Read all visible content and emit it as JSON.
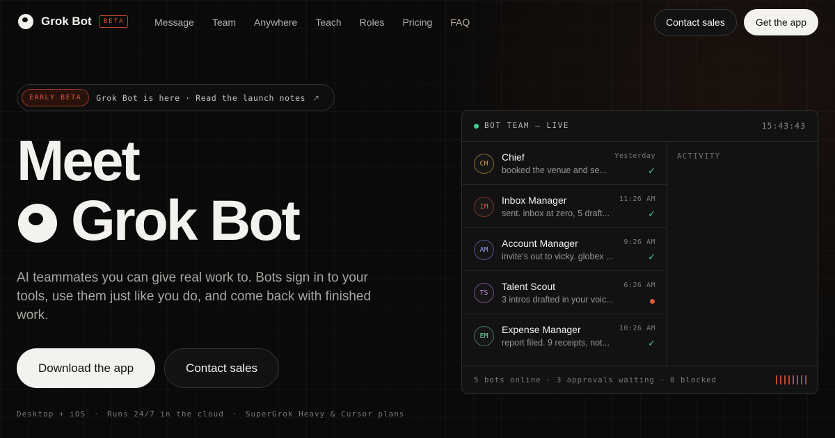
{
  "nav": {
    "brand": "Grok Bot",
    "beta_badge": "BETA",
    "links": [
      "Message",
      "Team",
      "Anywhere",
      "Teach",
      "Roles",
      "Pricing",
      "FAQ"
    ],
    "contact_sales": "Contact sales",
    "get_app": "Get the app"
  },
  "announce": {
    "badge": "EARLY BETA",
    "text": "Grok Bot is here · Read the launch notes",
    "arrow": "↗"
  },
  "hero": {
    "line1": "Meet",
    "line2": "Grok Bot",
    "subtitle": "AI teammates you can give real work to. Bots sign in to your tools, use them just like you do, and come back with finished work.",
    "download_button": "Download the app",
    "contact_button": "Contact sales",
    "footnotes": [
      "Desktop + iOS",
      "Runs 24/7 in the cloud",
      "SuperGrok Heavy & Cursor plans"
    ],
    "footnote_sep": "·"
  },
  "panel": {
    "title": "BOT TEAM — LIVE",
    "clock": "15:43:43",
    "activity_label": "ACTIVITY",
    "footer": "5 bots online · 3 approvals waiting · 0 blocked",
    "bots": [
      {
        "initials": "CH",
        "name": "Chief",
        "message": "booked the venue and se...",
        "time": "Yesterday",
        "status": "✓",
        "color": "#d9a24a"
      },
      {
        "initials": "IM",
        "name": "Inbox Manager",
        "message": "sent. inbox at zero, 5 draft...",
        "time": "11:26 AM",
        "status": "✓",
        "color": "#d0583e"
      },
      {
        "initials": "AM",
        "name": "Account Manager",
        "message": "invite's out to vicky. globex ...",
        "time": "9:26 AM",
        "status": "✓",
        "color": "#7f8ee0"
      },
      {
        "initials": "TS",
        "name": "Talent Scout",
        "message": "3 intros drafted in your voic...",
        "time": "6:26 AM",
        "status": "dot",
        "color": "#b77fd9"
      },
      {
        "initials": "EM",
        "name": "Expense Manager",
        "message": "report filed. 9 receipts, not...",
        "time": "10:26 AM",
        "status": "✓",
        "color": "#5cc89a"
      }
    ]
  }
}
